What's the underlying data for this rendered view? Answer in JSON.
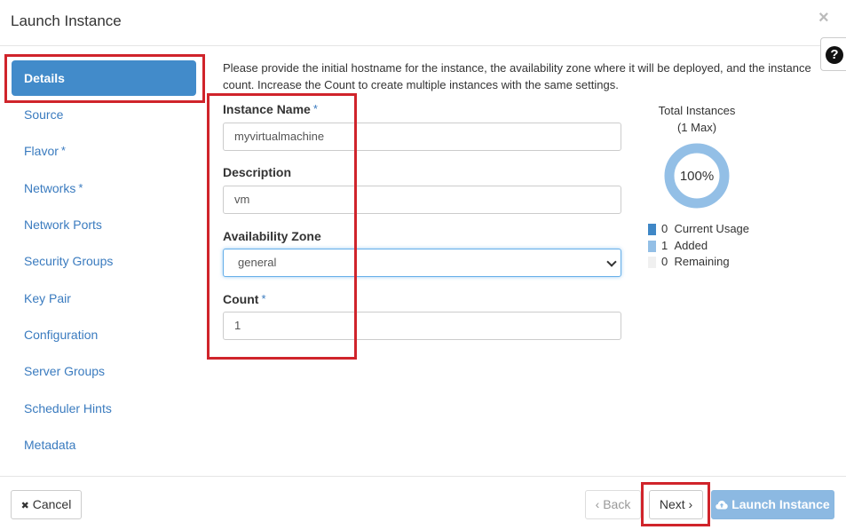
{
  "dialog": {
    "title": "Launch Instance",
    "close_icon": "×",
    "help_icon": "?"
  },
  "sidebar": {
    "items": [
      {
        "label": "Details",
        "active": true,
        "required": false
      },
      {
        "label": "Source",
        "required": false
      },
      {
        "label": "Flavor",
        "required": true
      },
      {
        "label": "Networks",
        "required": true
      },
      {
        "label": "Network Ports",
        "required": false
      },
      {
        "label": "Security Groups",
        "required": false
      },
      {
        "label": "Key Pair",
        "required": false
      },
      {
        "label": "Configuration",
        "required": false
      },
      {
        "label": "Server Groups",
        "required": false
      },
      {
        "label": "Scheduler Hints",
        "required": false
      },
      {
        "label": "Metadata",
        "required": false
      }
    ],
    "required_marker": "*"
  },
  "main": {
    "intro": "Please provide the initial hostname for the instance, the availability zone where it will be deployed, and the instance count. Increase the Count to create multiple instances with the same settings.",
    "fields": {
      "instance_name": {
        "label": "Instance Name",
        "value": "myvirtualmachine"
      },
      "description": {
        "label": "Description",
        "value": "vm"
      },
      "availability_zone": {
        "label": "Availability Zone",
        "value": "general"
      },
      "count": {
        "label": "Count",
        "value": "1"
      }
    }
  },
  "quota": {
    "title": "Total Instances",
    "subtitle": "(1 Max)",
    "percent_label": "100%",
    "legend": [
      {
        "count": "0",
        "label": "Current Usage",
        "color": "#3f87c6"
      },
      {
        "count": "1",
        "label": "Added",
        "color": "#93bfe6"
      },
      {
        "count": "0",
        "label": "Remaining",
        "color": "#f0f0f0"
      }
    ],
    "ring_color": "#93bfe6"
  },
  "footer": {
    "cancel_label": "Cancel",
    "cancel_icon": "✖",
    "back_label": "‹ Back",
    "next_label": "Next ›",
    "launch_label": "Launch Instance",
    "launch_icon": "cloud-upload-icon"
  }
}
